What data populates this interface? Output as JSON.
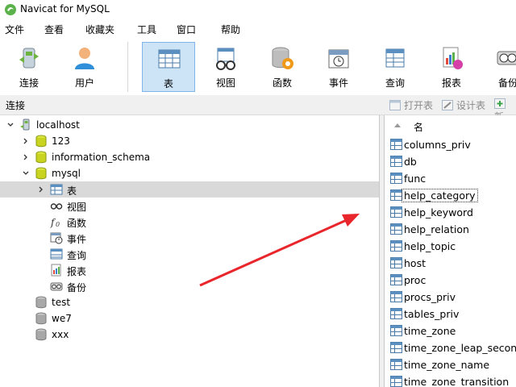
{
  "window": {
    "title": "Navicat for MySQL"
  },
  "menu": [
    "文件",
    "查看",
    "收藏夹",
    "工具",
    "窗口",
    "帮助"
  ],
  "toolbar": [
    {
      "label": "连接",
      "icon": "connection-icon"
    },
    {
      "label": "用户",
      "icon": "user-icon"
    },
    {
      "label": "表",
      "icon": "table-icon",
      "active": true
    },
    {
      "label": "视图",
      "icon": "view-icon"
    },
    {
      "label": "函数",
      "icon": "function-icon"
    },
    {
      "label": "事件",
      "icon": "event-icon"
    },
    {
      "label": "查询",
      "icon": "query-icon"
    },
    {
      "label": "报表",
      "icon": "report-icon"
    },
    {
      "label": "备份",
      "icon": "backup-icon"
    }
  ],
  "subbar": {
    "left_label": "连接",
    "open_table": "打开表",
    "design_table": "设计表",
    "new_table": "新"
  },
  "tree": {
    "root": "localhost",
    "databases": [
      "123",
      "information_schema",
      "mysql"
    ],
    "mysql_children": [
      "表",
      "视图",
      "函数",
      "事件",
      "查询",
      "报表",
      "备份"
    ],
    "other_databases": [
      "test",
      "we7",
      "xxx"
    ]
  },
  "list": {
    "header": "名",
    "items": [
      "columns_priv",
      "db",
      "func",
      "help_category",
      "help_keyword",
      "help_relation",
      "help_topic",
      "host",
      "proc",
      "procs_priv",
      "tables_priv",
      "time_zone",
      "time_zone_leap_second",
      "time_zone_name",
      "time_zone_transition"
    ],
    "focused_item": "help_category"
  },
  "colors": {
    "accent_selected": "#cde4f7",
    "annotation_arrow": "#e8262b",
    "db_icon_green": "#c8d41f",
    "db_icon_grey": "#a8a8a8"
  }
}
